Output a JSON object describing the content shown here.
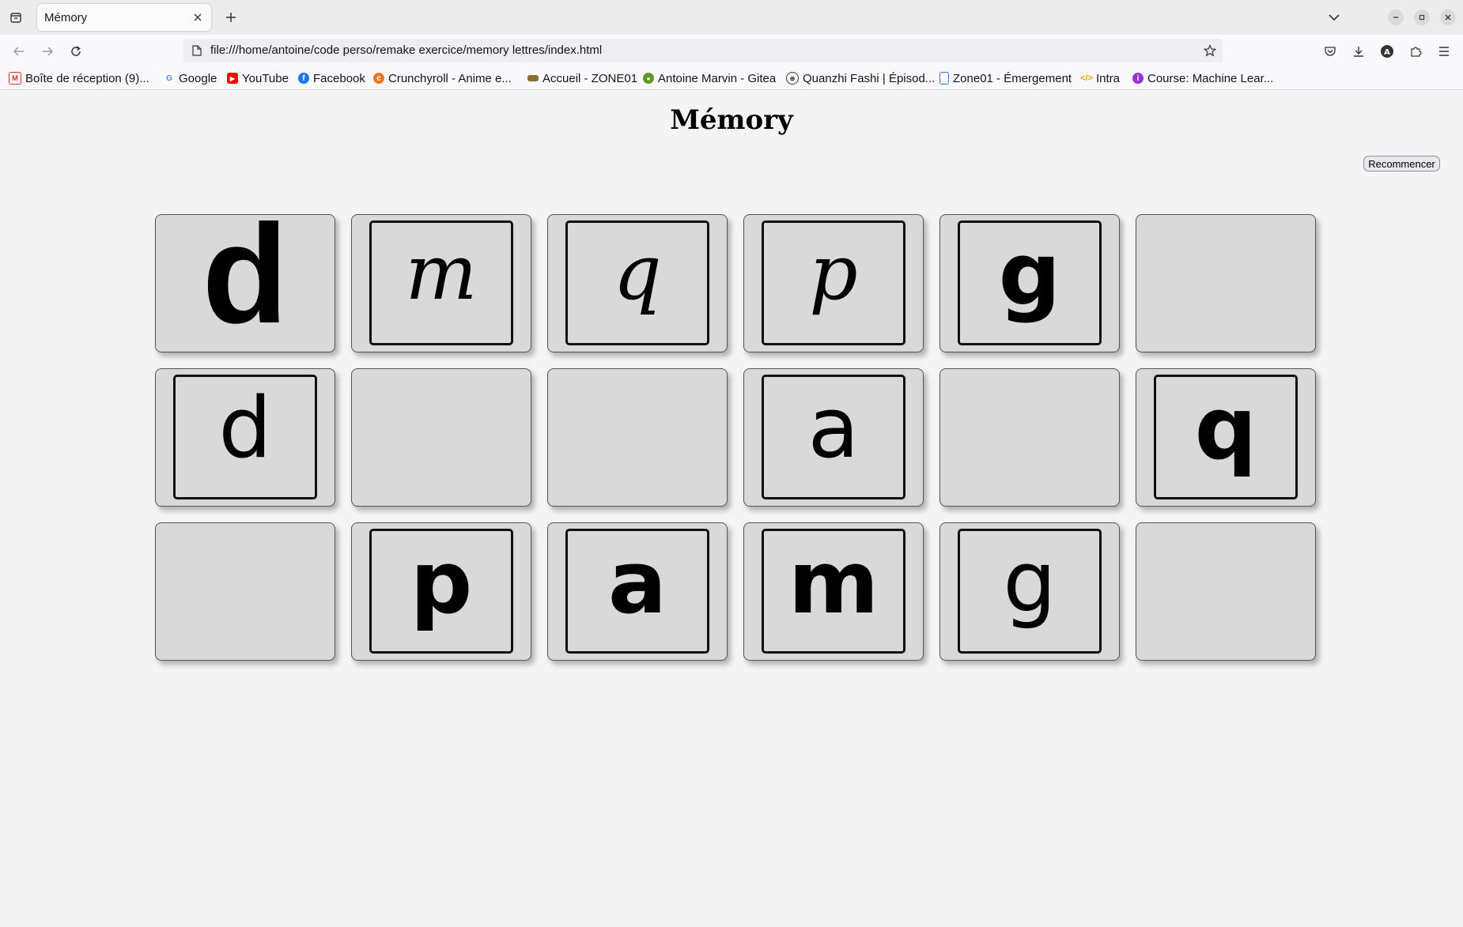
{
  "browser": {
    "tab_title": "Mémory",
    "url": "file:///home/antoine/code perso/remake exercice/memory lettres/index.html",
    "bookmarks": [
      {
        "label": "Boîte de réception (9)...",
        "icon": "gmail-icon",
        "color": "#d93025"
      },
      {
        "label": "Google",
        "icon": "google-icon",
        "color": "#4285f4"
      },
      {
        "label": "YouTube",
        "icon": "youtube-icon",
        "color": "#ff0000"
      },
      {
        "label": "Facebook",
        "icon": "facebook-icon",
        "color": "#1877f2"
      },
      {
        "label": "Crunchyroll - Anime e...",
        "icon": "crunchyroll-icon",
        "color": "#f47521"
      },
      {
        "label": "Accueil - ZONE01",
        "icon": "zone01-icon",
        "color": "#8a6d3b"
      },
      {
        "label": "Antoine Marvin - Gitea",
        "icon": "gitea-icon",
        "color": "#609926"
      },
      {
        "label": "Quanzhi Fashi | Épisod...",
        "icon": "globe-icon",
        "color": "#333333"
      },
      {
        "label": "Zone01 - Émergement",
        "icon": "document-icon",
        "color": "#3b6fd8"
      },
      {
        "label": "Intra",
        "icon": "code-icon",
        "color": "#e6a700"
      },
      {
        "label": "Course: Machine Lear...",
        "icon": "course-icon",
        "color": "#9b30d9"
      }
    ]
  },
  "page": {
    "title": "Mémory",
    "restart_label": "Recommencer"
  },
  "cards": [
    {
      "face": "up",
      "letter": "d",
      "style": "big"
    },
    {
      "face": "up",
      "letter": "m",
      "style": "italic"
    },
    {
      "face": "up",
      "letter": "q",
      "style": "italic"
    },
    {
      "face": "up",
      "letter": "p",
      "style": "italic"
    },
    {
      "face": "up",
      "letter": "g",
      "style": "bold"
    },
    {
      "face": "down",
      "letter": "",
      "style": ""
    },
    {
      "face": "up",
      "letter": "d",
      "style": "print"
    },
    {
      "face": "down",
      "letter": "",
      "style": ""
    },
    {
      "face": "down",
      "letter": "",
      "style": ""
    },
    {
      "face": "up",
      "letter": "a",
      "style": "print"
    },
    {
      "face": "down",
      "letter": "",
      "style": ""
    },
    {
      "face": "up",
      "letter": "q",
      "style": "bold"
    },
    {
      "face": "down",
      "letter": "",
      "style": ""
    },
    {
      "face": "up",
      "letter": "p",
      "style": "bold"
    },
    {
      "face": "up",
      "letter": "a",
      "style": "bold"
    },
    {
      "face": "up",
      "letter": "m",
      "style": "bold"
    },
    {
      "face": "up",
      "letter": "g",
      "style": "print"
    },
    {
      "face": "down",
      "letter": "",
      "style": ""
    }
  ]
}
